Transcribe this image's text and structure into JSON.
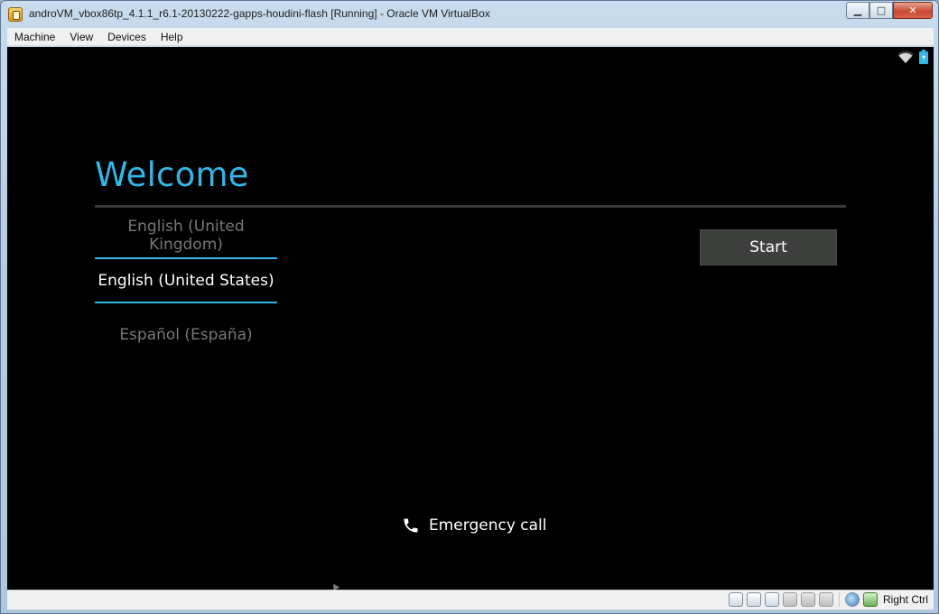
{
  "window": {
    "title": "androVM_vbox86tp_4.1.1_r6.1-20130222-gapps-houdini-flash [Running] - Oracle VM VirtualBox",
    "controls": {
      "minimize": "▁",
      "maximize": "□",
      "close": "✕"
    }
  },
  "menubar": {
    "items": [
      "Machine",
      "View",
      "Devices",
      "Help"
    ]
  },
  "android": {
    "status_icons": [
      "wifi-icon",
      "battery-icon"
    ],
    "welcome_title": "Welcome",
    "languages": [
      "English (United Kingdom)",
      "English (United States)",
      "Español (España)"
    ],
    "selected_language": "English (United States)",
    "start_label": "Start",
    "emergency_label": "Emergency call",
    "accent_color": "#33b5e5"
  },
  "statusbar": {
    "icons": [
      "hard-disk-icon",
      "optical-drive-icon",
      "usb-icon",
      "shared-folder-icon",
      "floppy-icon",
      "display-icon",
      "network-icon",
      "mouse-integration-icon"
    ],
    "host_key": "Right Ctrl"
  }
}
